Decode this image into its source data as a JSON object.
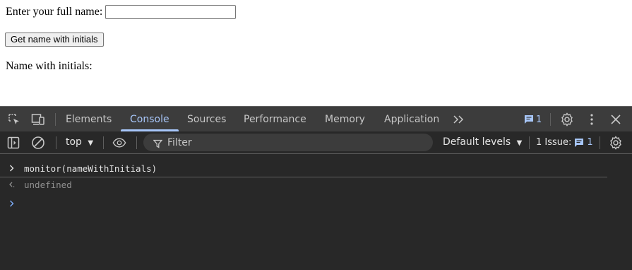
{
  "page": {
    "name_label": "Enter your full name:",
    "name_value": "",
    "button_label": "Get name with initials",
    "result_label": "Name with initials:"
  },
  "devtools": {
    "tabs": [
      "Elements",
      "Console",
      "Sources",
      "Performance",
      "Memory",
      "Application"
    ],
    "active_tab": "Console",
    "message_count": "1",
    "context": "top",
    "filter_placeholder": "Filter",
    "default_levels": "Default levels",
    "issues_label": "1 Issue:",
    "issues_count": "1",
    "console_lines": [
      {
        "type": "input",
        "text": "monitor(nameWithInitials)"
      },
      {
        "type": "result",
        "text": "undefined"
      }
    ],
    "colors": {
      "accent": "#a8c7fa",
      "panel_bg": "#282828",
      "tabbar_bg": "#3c3c3c"
    }
  }
}
